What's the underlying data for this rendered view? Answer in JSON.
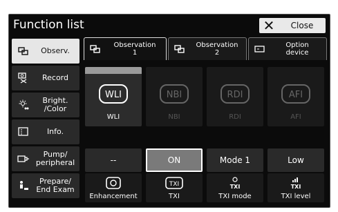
{
  "window": {
    "title": "Function list",
    "close_label": "Close"
  },
  "sidebar": {
    "items": [
      {
        "label": "Observ.",
        "icon": "observ-icon",
        "active": true
      },
      {
        "label": "Record",
        "icon": "record-icon",
        "active": false
      },
      {
        "label": "Bright.\n/Color",
        "icon": "brightness-icon",
        "active": false
      },
      {
        "label": "Info.",
        "icon": "info-icon",
        "active": false
      },
      {
        "label": "Pump/\nperipheral",
        "icon": "pump-icon",
        "active": false
      },
      {
        "label": "Prepare/\nEnd Exam",
        "icon": "prepare-icon",
        "active": false
      }
    ]
  },
  "tabs": [
    {
      "label": "Observation\n1",
      "active": true
    },
    {
      "label": "Observation\n2",
      "active": false
    },
    {
      "label": "Option\ndevice",
      "active": false
    }
  ],
  "modes": [
    {
      "glyph": "WLI",
      "label": "WLI",
      "enabled": true,
      "selected": true
    },
    {
      "glyph": "NBI",
      "label": "NBI",
      "enabled": false,
      "selected": false
    },
    {
      "glyph": "RDI",
      "label": "RDI",
      "enabled": false,
      "selected": false
    },
    {
      "glyph": "AFI",
      "label": "AFI",
      "enabled": false,
      "selected": false
    }
  ],
  "settings": [
    {
      "value": "--",
      "label": "Enhancement",
      "icon": "enhancement-icon",
      "highlighted": false
    },
    {
      "value": "ON",
      "label": "TXI",
      "icon": "txi-icon",
      "highlighted": true
    },
    {
      "value": "Mode 1",
      "label": "TXI mode",
      "icon": "txi-mode-icon",
      "highlighted": false
    },
    {
      "value": "Low",
      "label": "TXI level",
      "icon": "txi-level-icon",
      "highlighted": false
    }
  ],
  "icon_text": {
    "txi": "TXI"
  },
  "colors": {
    "background": "#0b0b0b",
    "highlight": "#7a7a7a",
    "active_tab": "#e6e6e6"
  }
}
